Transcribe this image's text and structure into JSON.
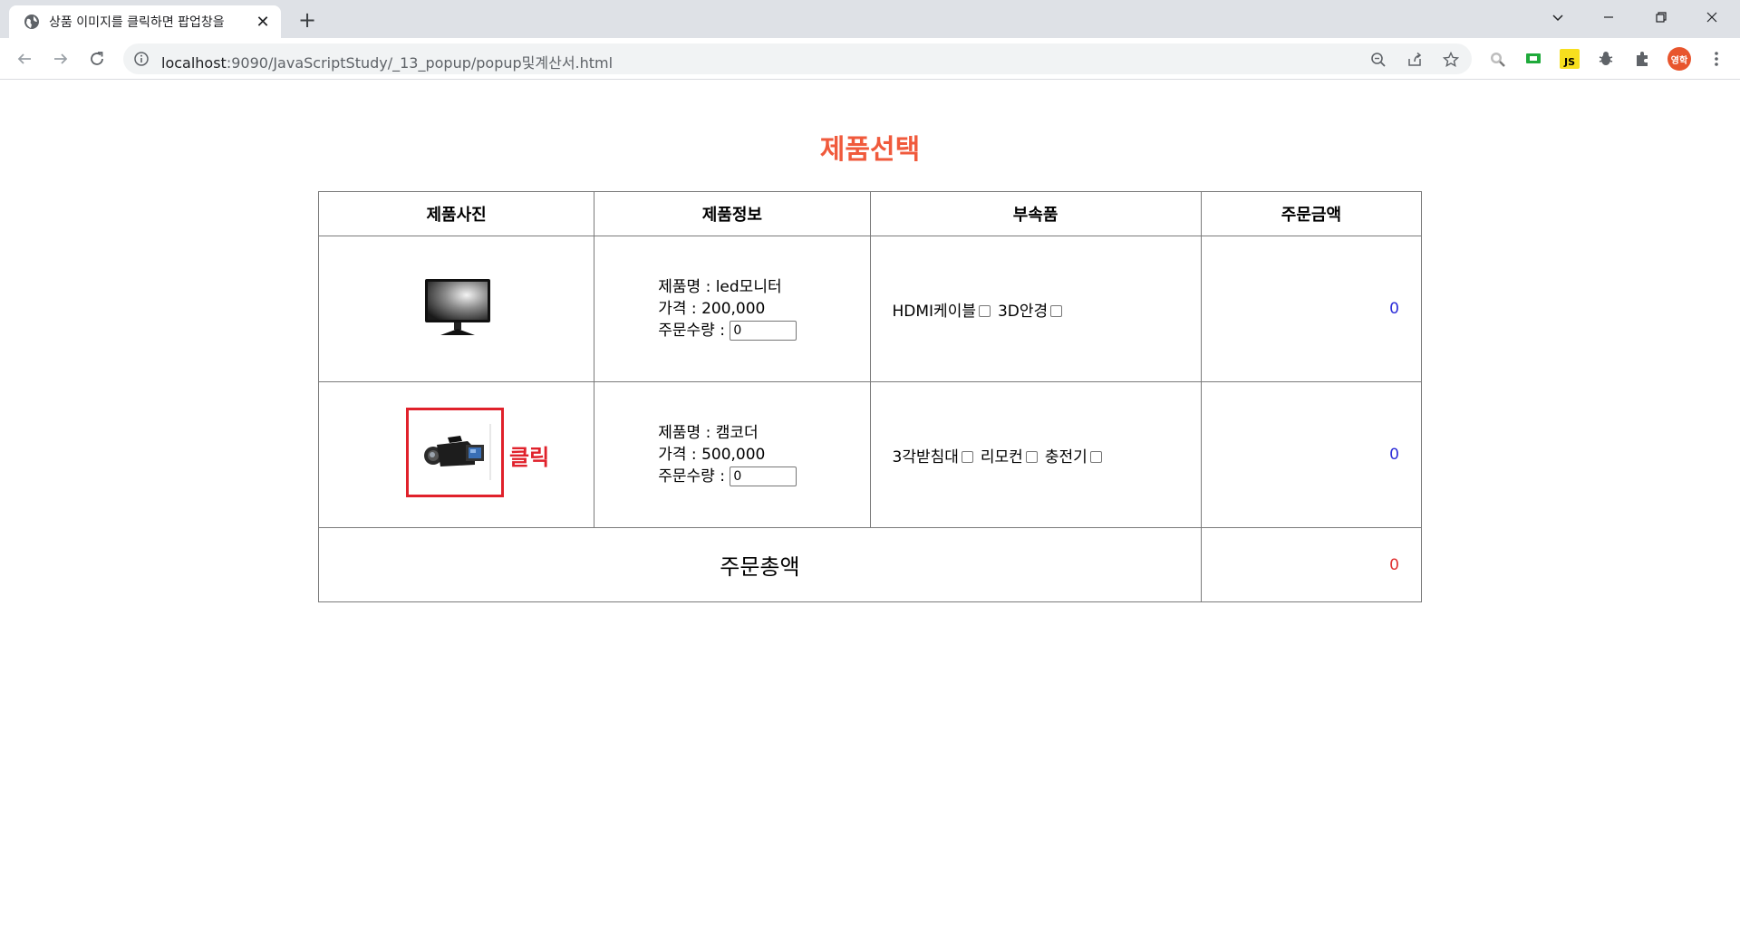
{
  "browser": {
    "tab_title": "상품 이미지를 클릭하면 팝업창을",
    "url_host": "localhost",
    "url_path": ":9090/JavaScriptStudy/_13_popup/popup및계산서.html",
    "profile_initials": "영학",
    "ext_js_label": "JS"
  },
  "page": {
    "title": "제품선택"
  },
  "table": {
    "headers": [
      "제품사진",
      "제품정보",
      "부속품",
      "주문금액"
    ],
    "rows": [
      {
        "name_line": "제품명 : led모니터",
        "price_line": "가격 : 200,000",
        "qty_label": "주문수량 :",
        "qty_value": "0",
        "accessories": [
          "HDMI케이블",
          "3D안경"
        ],
        "amount": "0",
        "image": "monitor"
      },
      {
        "name_line": "제품명 : 캠코더",
        "price_line": "가격 : 500,000",
        "qty_label": "주문수량 :",
        "qty_value": "0",
        "accessories": [
          "3각받침대",
          "리모컨",
          "충전기"
        ],
        "amount": "0",
        "image": "camcorder",
        "annotation": "클릭"
      }
    ],
    "total_label": "주문총액",
    "total_amount": "0"
  },
  "colors": {
    "title": "#f05a3c",
    "amount": "#2b2bd8",
    "total": "#e03030",
    "annotation": "#e0212b"
  }
}
